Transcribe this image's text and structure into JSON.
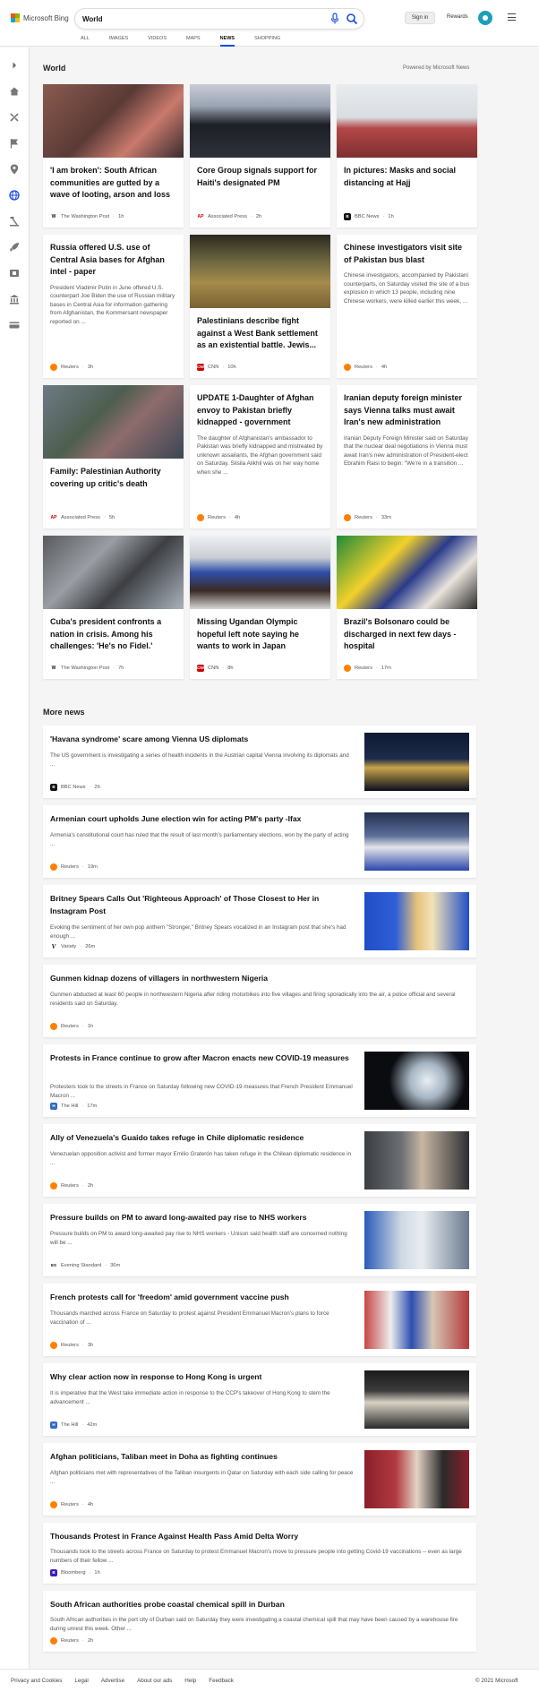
{
  "header": {
    "logo_text": "Microsoft Bing",
    "search_value": "World",
    "signin_label": "Sign in",
    "rewards_label": "Rewards",
    "tabs": [
      {
        "label": "ALL"
      },
      {
        "label": "IMAGES"
      },
      {
        "label": "VIDEOS"
      },
      {
        "label": "MAPS"
      },
      {
        "label": "NEWS"
      },
      {
        "label": "SHOPPING"
      }
    ],
    "active_tab": "NEWS",
    "accent_color": "#174ae4"
  },
  "sidebar": {
    "icons": [
      "chevron-right-icon",
      "home-icon",
      "tools-icon",
      "flag-icon",
      "location-icon",
      "globe-icon",
      "scale-icon",
      "rocket-icon",
      "film-icon",
      "bank-icon",
      "credit-card-icon"
    ],
    "active_icon": "globe-icon"
  },
  "world": {
    "title": "World",
    "powered_by": "Powered by Microsoft News",
    "cards": [
      {
        "headline": "'I am broken': South African communities are gutted by a wave of looting, arson and loss",
        "snippet": "",
        "publisher": "The Washington Post",
        "time": "1h",
        "logo": "wp"
      },
      {
        "headline": "Core Group signals support for Haiti's designated PM",
        "snippet": "",
        "publisher": "Associated Press",
        "time": "2h",
        "logo": "ap"
      },
      {
        "headline": "In pictures: Masks and social distancing at Hajj",
        "snippet": "",
        "publisher": "BBC News",
        "time": "1h",
        "logo": "bbc"
      },
      {
        "headline": "Russia offered U.S. use of Central Asia bases for Afghan intel - paper",
        "snippet": "President Vladimir Putin in June offered U.S. counterpart Joe Biden the use of Russian military bases in Central Asia for information gathering from Afghanistan, the Kommersant newspaper reported on ...",
        "publisher": "Reuters",
        "time": "3h",
        "logo": "reuters"
      },
      {
        "headline": "Palestinians describe fight against a West Bank settlement as an existential battle. Jewis...",
        "snippet": "",
        "publisher": "CNN",
        "time": "10h",
        "logo": "cnn"
      },
      {
        "headline": "Chinese investigators visit site of Pakistan bus blast",
        "snippet": "Chinese investigators, accompanied by Pakistani counterparts, on Saturday visited the site of a bus explosion in which 13 people, including nine Chinese workers, were killed earlier this week, ...",
        "publisher": "Reuters",
        "time": "4h",
        "logo": "reuters"
      },
      {
        "headline": "Family: Palestinian Authority covering up critic's death",
        "snippet": "",
        "publisher": "Associated Press",
        "time": "5h",
        "logo": "ap"
      },
      {
        "headline": "UPDATE 1-Daughter of Afghan envoy to Pakistan briefly kidnapped - government",
        "snippet": "The daughter of Afghanistan's ambassador to Pakistan was briefly kidnapped and mistreated by unknown assailants, the Afghan government said on Saturday. Silsila Alikhil was on her way home when she ...",
        "publisher": "Reuters",
        "time": "4h",
        "logo": "reuters"
      },
      {
        "headline": "Iranian deputy foreign minister says Vienna talks must await Iran's new administration",
        "snippet": "Iranian Deputy Foreign Minister said on Saturday that the nuclear deal negotiations in Vienna must await Iran's new administration of President-elect Ebrahim Raisi to begin: \"We're in a transition ...",
        "publisher": "Reuters",
        "time": "33m",
        "logo": "reuters"
      },
      {
        "headline": "Cuba's president confronts a nation in crisis. Among his challenges: 'He's no Fidel.'",
        "snippet": "",
        "publisher": "The Washington Post",
        "time": "7h",
        "logo": "wp"
      },
      {
        "headline": "Missing Ugandan Olympic hopeful left note saying he wants to work in Japan",
        "snippet": "",
        "publisher": "CNN",
        "time": "8h",
        "logo": "cnn"
      },
      {
        "headline": "Brazil's Bolsonaro could be discharged in next few days - hospital",
        "snippet": "",
        "publisher": "Reuters",
        "time": "17m",
        "logo": "reuters"
      }
    ]
  },
  "more_news": {
    "title": "More news",
    "items": [
      {
        "headline": "'Havana syndrome' scare among Vienna US diplomats",
        "snippet": "The US government is investigating a series of health incidents in the Austrian capital Vienna involving its diplomats and ...",
        "publisher": "BBC News",
        "time": "2h",
        "logo": "bbc",
        "has_image": true
      },
      {
        "headline": "Armenian court upholds June election win for acting PM's party -Ifax",
        "snippet": "Armenia's constitutional court has ruled that the result of last month's parliamentary elections, won by the party of acting ...",
        "publisher": "Reuters",
        "time": "19m",
        "logo": "reuters",
        "has_image": true
      },
      {
        "headline": "Britney Spears Calls Out 'Righteous Approach' of Those Closest to Her in Instagram Post",
        "snippet": "Evoking the sentiment of her own pop anthem \"Stronger,\" Britney Spears vocalized in an Instagram post that she's had enough ...",
        "publisher": "Variety",
        "time": "26m",
        "logo": "variety",
        "has_image": true
      },
      {
        "headline": "Gunmen kidnap dozens of villagers in northwestern Nigeria",
        "snippet": "Gunmen abducted at least 60 people in northwestern Nigeria after riding motorbikes into five villages and firing sporadically into the air, a police official and several residents said on Saturday.",
        "publisher": "Reuters",
        "time": "1h",
        "logo": "reuters",
        "has_image": false
      },
      {
        "headline": "Protests in France continue to grow after Macron enacts new COVID-19 measures",
        "snippet": "Protesters took to the streets in France on Saturday following new COVID-19 measures that French President Emmanuel Macron ...",
        "publisher": "The Hill",
        "time": "17m",
        "logo": "hill",
        "has_image": true
      },
      {
        "headline": "Ally of Venezuela's Guaido takes refuge in Chile diplomatic residence",
        "snippet": "Venezuelan opposition activist and former mayor Emilio Graterón has taken refuge in the Chilean diplomatic residence in ...",
        "publisher": "Reuters",
        "time": "2h",
        "logo": "reuters",
        "has_image": true
      },
      {
        "headline": "Pressure builds on PM to award long-awaited pay rise to NHS workers",
        "snippet": "Pressure builds on PM to award long-awaited pay rise to NHS workers - Unison said health staff are concerned nothing will be ...",
        "publisher": "Evening Standard",
        "time": "36m",
        "logo": "es",
        "has_image": true
      },
      {
        "headline": "French protests call for 'freedom' amid government vaccine push",
        "snippet": "Thousands marched across France on Saturday to protest against President Emmanuel Macron's plans to force vaccination of ...",
        "publisher": "Reuters",
        "time": "3h",
        "logo": "reuters",
        "has_image": true
      },
      {
        "headline": "Why clear action now in response to Hong Kong is urgent",
        "snippet": "It is imperative that the West take immediate action in response to the CCP's takeover of Hong Kong to stem the advancement ...",
        "publisher": "The Hill",
        "time": "42m",
        "logo": "hill",
        "has_image": true
      },
      {
        "headline": "Afghan politicians, Taliban meet in Doha as fighting continues",
        "snippet": "Afghan politicians met with representatives of the Taliban insurgents in Qatar on Saturday with each side calling for peace ...",
        "publisher": "Reuters",
        "time": "4h",
        "logo": "reuters",
        "has_image": true
      },
      {
        "headline": "Thousands Protest in France Against Health Pass Amid Delta Worry",
        "snippet": "Thousands took to the streets across France on Saturday to protest Emmanuel Macron's move to pressure people into getting Covid-19 vaccinations -- even as large numbers of their fellow ...",
        "publisher": "Bloomberg",
        "time": "1h",
        "logo": "bloomberg",
        "has_image": false
      },
      {
        "headline": "South African authorities probe coastal chemical spill in Durban",
        "snippet": "South African authorities in the port city of Durban said on Saturday they were investigating a coastal chemical spill that may have been caused by a warehouse fire during unrest this week. Other ...",
        "publisher": "Reuters",
        "time": "2h",
        "logo": "reuters",
        "has_image": false
      }
    ]
  },
  "footer": {
    "links": [
      {
        "label": "Privacy and Cookies"
      },
      {
        "label": "Legal"
      },
      {
        "label": "Advertise"
      },
      {
        "label": "About our ads"
      },
      {
        "label": "Help"
      },
      {
        "label": "Feedback"
      }
    ],
    "copyright": "© 2021 Microsoft"
  }
}
